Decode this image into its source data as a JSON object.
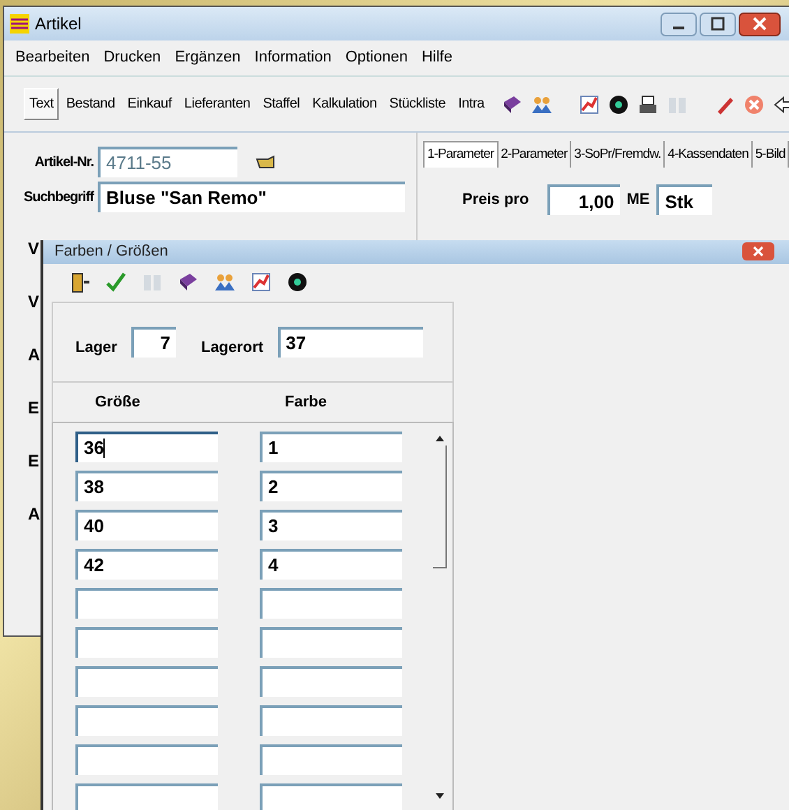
{
  "main_window": {
    "title": "Artikel",
    "menu": [
      "Bearbeiten",
      "Drucken",
      "Ergänzen",
      "Information",
      "Optionen",
      "Hilfe"
    ],
    "view_buttons": [
      {
        "label": "Text",
        "selected": true
      },
      {
        "label": "Bestand",
        "selected": false
      },
      {
        "label": "Einkauf",
        "selected": false
      },
      {
        "label": "Lieferanten",
        "selected": false
      },
      {
        "label": "Staffel",
        "selected": false
      },
      {
        "label": "Kalkulation",
        "selected": false
      },
      {
        "label": "Stückliste",
        "selected": false
      },
      {
        "label": "Intra",
        "selected": false
      }
    ],
    "fields": [
      {
        "label": "Artikel-Nr.",
        "value": "4711-55",
        "kind": "number"
      },
      {
        "label": "Suchbegriff",
        "value": "Bluse \"San Remo\"",
        "kind": "wide"
      }
    ],
    "hidden_labels": [
      "V",
      "V",
      "A",
      "E",
      "E",
      "A"
    ],
    "tabs": [
      {
        "label": "1-Parameter",
        "selected": true
      },
      {
        "label": "2-Parameter",
        "selected": false
      },
      {
        "label": "3-SoPr/Fremdw.",
        "selected": false
      },
      {
        "label": "4-Kassendaten",
        "selected": false
      },
      {
        "label": "5-Bild",
        "selected": false
      }
    ],
    "price": {
      "label": "Preis pro",
      "value": "1,00",
      "unit_label": "ME",
      "unit": "Stk"
    }
  },
  "dialog": {
    "title": "Farben / Größen",
    "lager": {
      "label": "Lager",
      "value": "7"
    },
    "lagerort": {
      "label": "Lagerort",
      "value": "37"
    },
    "columns": [
      "Größe",
      "Farbe"
    ],
    "rows": [
      {
        "kind": "filled",
        "size": "36",
        "color_code": "1",
        "focused": true
      },
      {
        "kind": "filled",
        "size": "38",
        "color_code": "2",
        "focused": false
      },
      {
        "kind": "filled",
        "size": "40",
        "color_code": "3",
        "focused": false
      },
      {
        "kind": "filled",
        "size": "42",
        "color_code": "4",
        "focused": false
      },
      {
        "kind": "empty"
      },
      {
        "kind": "empty"
      },
      {
        "kind": "empty"
      },
      {
        "kind": "empty"
      },
      {
        "kind": "empty"
      },
      {
        "kind": "empty"
      }
    ]
  }
}
